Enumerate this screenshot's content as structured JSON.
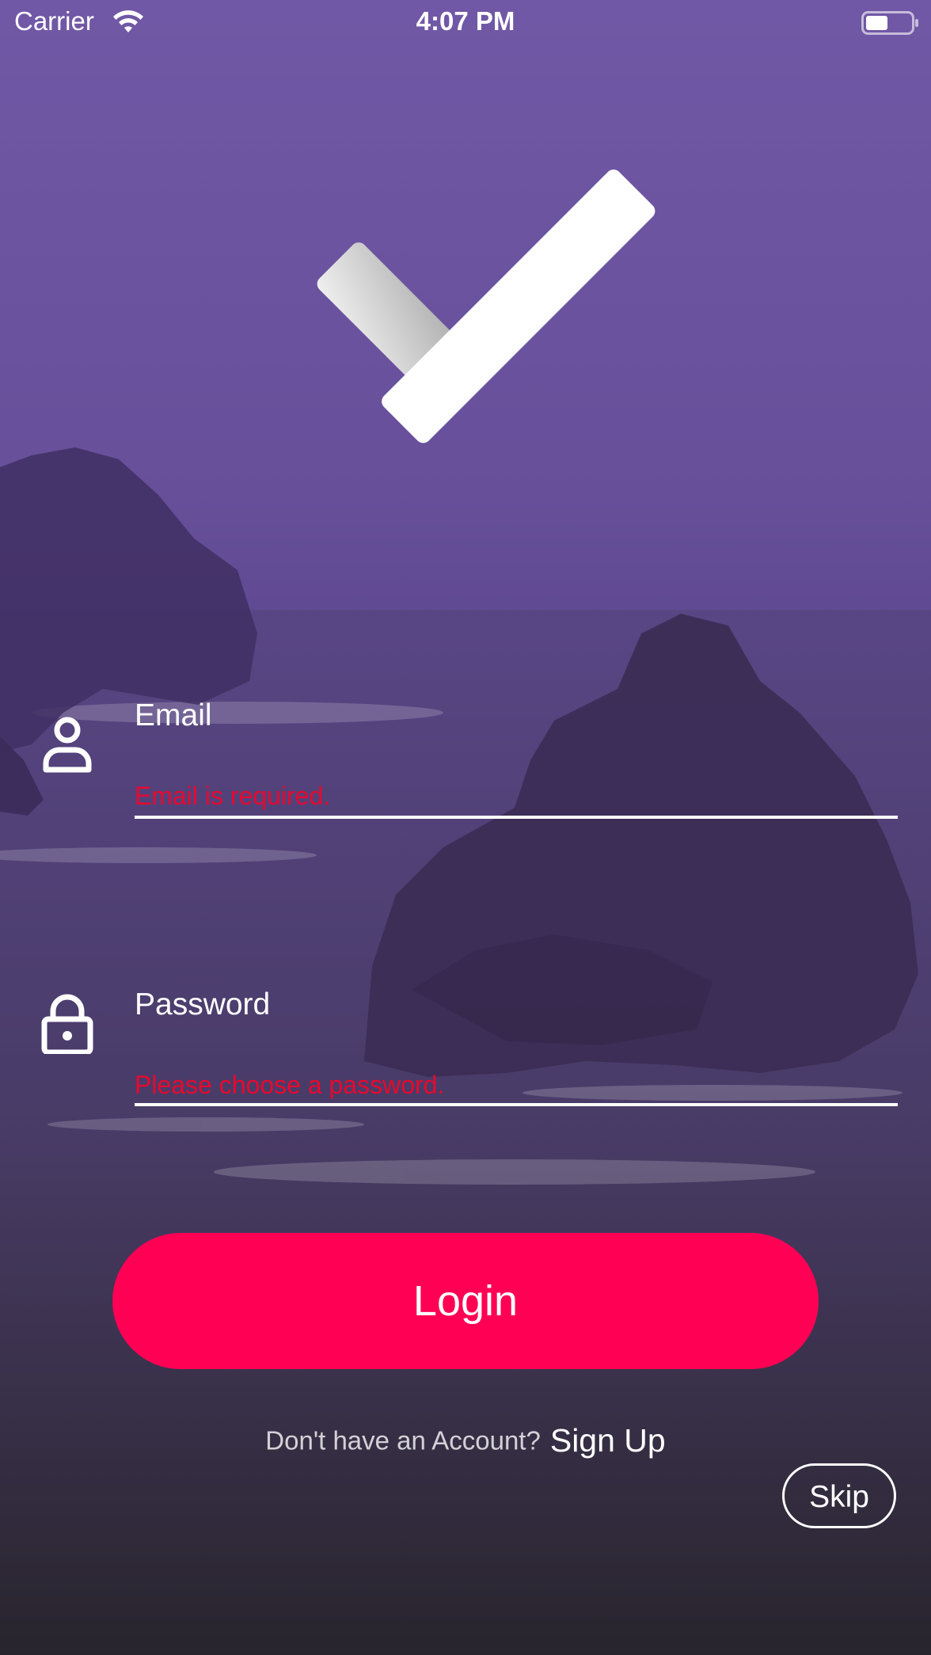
{
  "status_bar": {
    "carrier": "Carrier",
    "time": "4:07 PM",
    "wifi_icon": "wifi-icon",
    "battery_icon": "battery-icon"
  },
  "logo": {
    "icon": "checkmark-logo-icon"
  },
  "email_field": {
    "label": "Email",
    "icon": "person-icon",
    "value": "",
    "error": "Email is required."
  },
  "password_field": {
    "label": "Password",
    "icon": "lock-icon",
    "value": "",
    "error": "Please choose a password."
  },
  "login_button": {
    "label": "Login",
    "color": "#ff0055"
  },
  "signup": {
    "prompt": "Don't have an Account?",
    "link": "Sign Up"
  },
  "skip_button": {
    "label": "Skip"
  },
  "colors": {
    "background_top": "#6e57a3",
    "error": "#e8082e",
    "accent": "#ff0055"
  }
}
